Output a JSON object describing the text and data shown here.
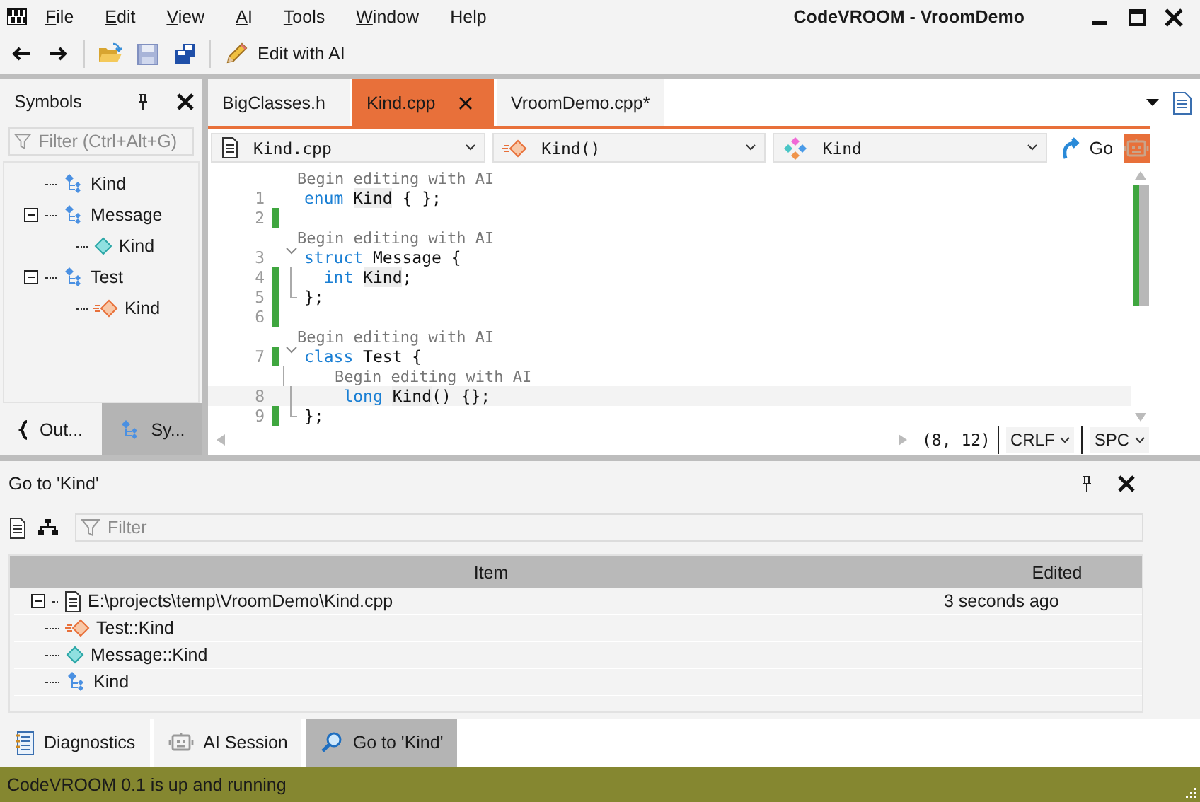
{
  "window": {
    "title": "CodeVROOM - VroomDemo"
  },
  "menu": [
    {
      "label": "File",
      "underline": true
    },
    {
      "label": "Edit",
      "underline": true
    },
    {
      "label": "View",
      "underline": true
    },
    {
      "label": "AI",
      "underline": true
    },
    {
      "label": "Tools",
      "underline": true
    },
    {
      "label": "Window",
      "underline": true
    },
    {
      "label": "Help",
      "underline": false
    }
  ],
  "toolbar": {
    "edit_ai": "Edit with AI"
  },
  "symbols": {
    "title": "Symbols",
    "filter": {
      "placeholder": "Filter (Ctrl+Alt+G)"
    },
    "tree": [
      {
        "label": "Kind",
        "kind": "class"
      },
      {
        "label": "Message",
        "kind": "class",
        "expanded": true,
        "children": [
          {
            "label": "Kind",
            "kind": "field"
          }
        ]
      },
      {
        "label": "Test",
        "kind": "class",
        "expanded": true,
        "children": [
          {
            "label": "Kind",
            "kind": "method"
          }
        ]
      }
    ],
    "tabs": [
      {
        "label": "Out...",
        "kind": "outline",
        "selected": false
      },
      {
        "label": "Sy...",
        "kind": "symbols",
        "selected": true
      }
    ]
  },
  "editor": {
    "tabs": [
      {
        "label": "BigClasses.h",
        "selected": false
      },
      {
        "label": "Kind.cpp",
        "selected": true
      },
      {
        "label": "VroomDemo.cpp*",
        "selected": false
      }
    ],
    "nav": [
      {
        "label": "Kind.cpp",
        "kind": "file"
      },
      {
        "label": "Kind()",
        "kind": "method"
      },
      {
        "label": "Kind",
        "kind": "enum"
      }
    ],
    "go": "Go",
    "lines": [
      {
        "kind": "hint",
        "text": "Begin editing with AI"
      },
      {
        "kind": "code",
        "number": "1",
        "changed": false,
        "tokens": [
          {
            "text": "enum ",
            "kind": "keyword"
          },
          {
            "text": "Kind",
            "kind": "match"
          },
          {
            "text": " { };",
            "kind": "text"
          }
        ]
      },
      {
        "kind": "code",
        "number": "2",
        "changed": true
      },
      {
        "kind": "hint",
        "text": "Begin editing with AI"
      },
      {
        "kind": "code",
        "number": "3",
        "changed": false,
        "expanded": true,
        "tokens": [
          {
            "text": "struct",
            "kind": "keyword"
          },
          {
            "text": " Message {",
            "kind": "text"
          }
        ]
      },
      {
        "kind": "code",
        "number": "4",
        "changed": true,
        "in_block": true,
        "tokens": [
          {
            "text": "  int ",
            "kind": "keyword"
          },
          {
            "text": "Kind",
            "kind": "match"
          },
          {
            "text": ";",
            "kind": "text"
          }
        ]
      },
      {
        "kind": "code",
        "number": "5",
        "changed": true,
        "block_end": true,
        "tokens": [
          {
            "text": "};",
            "kind": "text"
          }
        ]
      },
      {
        "kind": "code",
        "number": "6",
        "changed": true
      },
      {
        "kind": "hint",
        "text": "Begin editing with AI"
      },
      {
        "kind": "code",
        "number": "7",
        "changed": true,
        "expanded": true,
        "tokens": [
          {
            "text": "class",
            "kind": "keyword"
          },
          {
            "text": " Test {",
            "kind": "text"
          }
        ]
      },
      {
        "kind": "hint",
        "text": "    Begin editing with AI",
        "in_block": true
      },
      {
        "kind": "code",
        "number": "8",
        "changed": false,
        "current": true,
        "in_block": true,
        "tokens": [
          {
            "text": "    long ",
            "kind": "keyword"
          },
          {
            "text": "Kind",
            "kind": "match"
          },
          {
            "text": "() {};",
            "kind": "text"
          }
        ]
      },
      {
        "kind": "code",
        "number": "9",
        "changed": true,
        "block_end": true,
        "tokens": [
          {
            "text": "};",
            "kind": "text"
          }
        ]
      }
    ],
    "status": {
      "position": "(8, 12)",
      "eol": "CRLF",
      "indent": "SPC"
    }
  },
  "goto": {
    "title": "Go to 'Kind'",
    "filter": {
      "placeholder": "Filter"
    },
    "columns": [
      "Item",
      "Edited"
    ],
    "rows": [
      {
        "item": "E:\\projects\\temp\\VroomDemo\\Kind.cpp",
        "kind": "file",
        "edited": "3 seconds ago",
        "expanded": true,
        "children": [
          {
            "item": "Test::Kind",
            "kind": "method"
          },
          {
            "item": "Message::Kind",
            "kind": "field"
          },
          {
            "item": "Kind",
            "kind": "class"
          }
        ]
      }
    ]
  },
  "bottom_tabs": [
    {
      "label": "Diagnostics",
      "kind": "diagnostics",
      "selected": false
    },
    {
      "label": "AI Session",
      "kind": "ai",
      "selected": false
    },
    {
      "label": "Go to 'Kind'",
      "kind": "search",
      "selected": true
    }
  ],
  "status_bar": {
    "text": "CodeVROOM 0.1 is up and running"
  }
}
